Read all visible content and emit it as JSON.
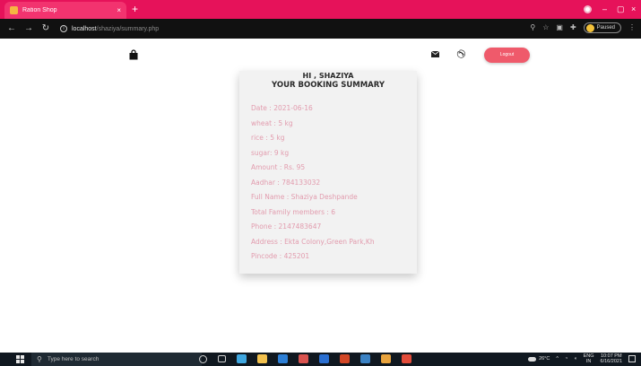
{
  "browser": {
    "tab_title": "Ration Shop",
    "tab_close": "×",
    "new_tab": "+",
    "url_host": "localhost",
    "url_path": "/shaziya/summary.php",
    "paused_label": "Paused",
    "minimize": "–",
    "restore": "▢",
    "close": "×",
    "accent_color": "#e6125a"
  },
  "navbar": {
    "logout_label": "Logout",
    "logout_color": "#ef5a6b"
  },
  "summary": {
    "greeting": "HI , SHAZIYA",
    "heading": "YOUR BOOKING SUMMARY",
    "details": [
      "Date : 2021-06-16",
      "wheat : 5 kg",
      "rice : 5 kg",
      "sugar: 9 kg",
      "Amount : Rs. 95",
      "Aadhar : 784133032",
      "Full Name : Shaziya Deshpande",
      "Total Family members : 6",
      "Phone : 2147483647",
      "Address : Ekta Colony,Green Park,Kh",
      "Pincode : 425201"
    ]
  },
  "taskbar": {
    "search_placeholder": "Type here to search",
    "weather": "26°C",
    "language_top": "ENG",
    "language_bottom": "IN",
    "time": "10:07 PM",
    "date": "6/16/2021"
  }
}
